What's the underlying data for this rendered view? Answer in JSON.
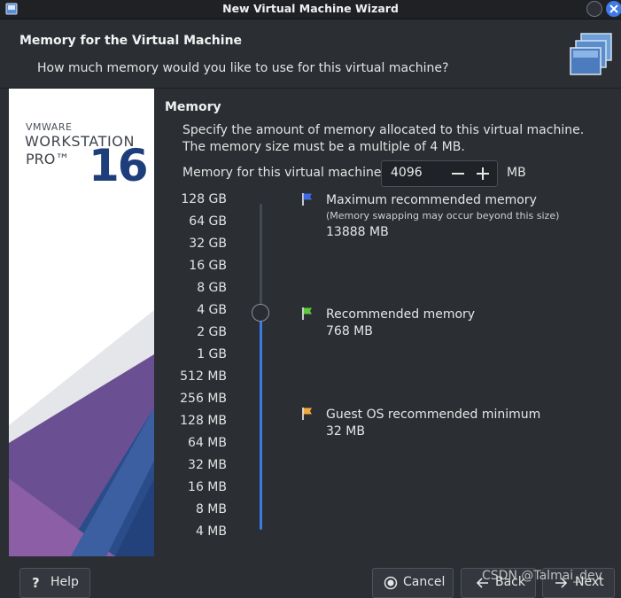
{
  "window": {
    "title": "New Virtual Machine Wizard"
  },
  "header": {
    "title": "Memory for the Virtual Machine",
    "subtitle": "How much memory would you like to use for this virtual machine?"
  },
  "brand": {
    "vmware": "VMWARE",
    "product": "WORKSTATION",
    "edition": "PRO™",
    "version": "16"
  },
  "memory": {
    "section_title": "Memory",
    "description": "Specify the amount of memory allocated to this virtual machine. The memory size must be a multiple of 4 MB.",
    "field_label": "Memory for this virtual machine:",
    "value": "4096",
    "unit": "MB",
    "scale": [
      "128 GB",
      "64 GB",
      "32 GB",
      "16 GB",
      "8 GB",
      "4 GB",
      "2 GB",
      "1 GB",
      "512 MB",
      "256 MB",
      "128 MB",
      "64 MB",
      "32 MB",
      "16 MB",
      "8 MB",
      "4 MB"
    ],
    "slider_position": "4 GB"
  },
  "recommendations": {
    "max": {
      "title": "Maximum recommended memory",
      "note": "(Memory swapping may occur beyond this size)",
      "value": "13888 MB",
      "color": "#3d6ae6"
    },
    "recommended": {
      "title": "Recommended memory",
      "value": "768 MB",
      "color": "#5ec93a"
    },
    "minimum": {
      "title": "Guest OS recommended minimum",
      "value": "32 MB",
      "color": "#f2a93b"
    }
  },
  "footer": {
    "help": "Help",
    "cancel": "Cancel",
    "back": "Back",
    "next": "Next",
    "watermark": "CSDN @Talmai_dev"
  }
}
